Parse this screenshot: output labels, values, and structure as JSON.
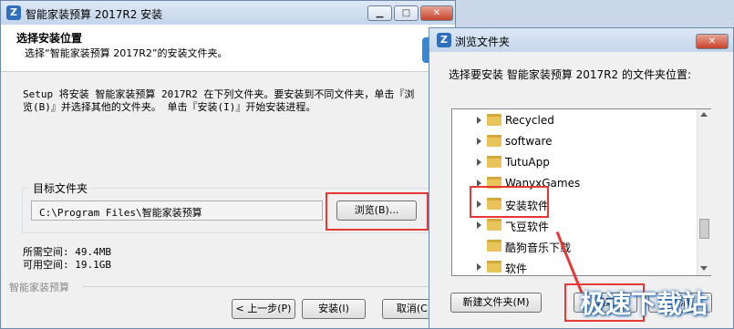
{
  "installer": {
    "title": "智能家装预算 2017R2 安装",
    "header_title": "选择安装位置",
    "header_subtitle": "选择“智能家装预算 2017R2”的安装文件夹。",
    "description_line1": "Setup 将安装 智能家装预算 2017R2 在下列文件夹。要安装到不同文件夹，单击『浏",
    "description_line2": "览(B)』并选择其他的文件夹。 单击『安装(I)』开始安装进程。",
    "group_label": "目标文件夹",
    "path_value": "C:\\Program Files\\智能家装预算",
    "browse_button": "浏览(B)...",
    "space_required": "所需空间: 49.4MB",
    "space_available": "可用空间: 19.1GB",
    "footer_brand": "智能家装预算",
    "back_button": "< 上一步(P)",
    "install_button": "安装(I)",
    "cancel_button": "取消(C)"
  },
  "dialog": {
    "title": "浏览文件夹",
    "prompt": "选择要安装 智能家装预算 2017R2 的文件夹位置:",
    "folders": [
      {
        "label": "Recycled",
        "has_children": true
      },
      {
        "label": "software",
        "has_children": true
      },
      {
        "label": "TutuApp",
        "has_children": true
      },
      {
        "label": "WanyxGames",
        "has_children": true
      },
      {
        "label": "安装软件",
        "has_children": true
      },
      {
        "label": "飞豆软件",
        "has_children": true
      },
      {
        "label": "酷狗音乐下载",
        "has_children": false
      },
      {
        "label": "软件",
        "has_children": true
      }
    ],
    "new_folder_button": "新建文件夹(M)",
    "ok_button": "确定",
    "cancel_button": "取消"
  },
  "watermark": "极速下载站",
  "colors": {
    "highlight": "#e53935",
    "folder": "#e8c45a",
    "titlebar": "#c4d5ea"
  }
}
